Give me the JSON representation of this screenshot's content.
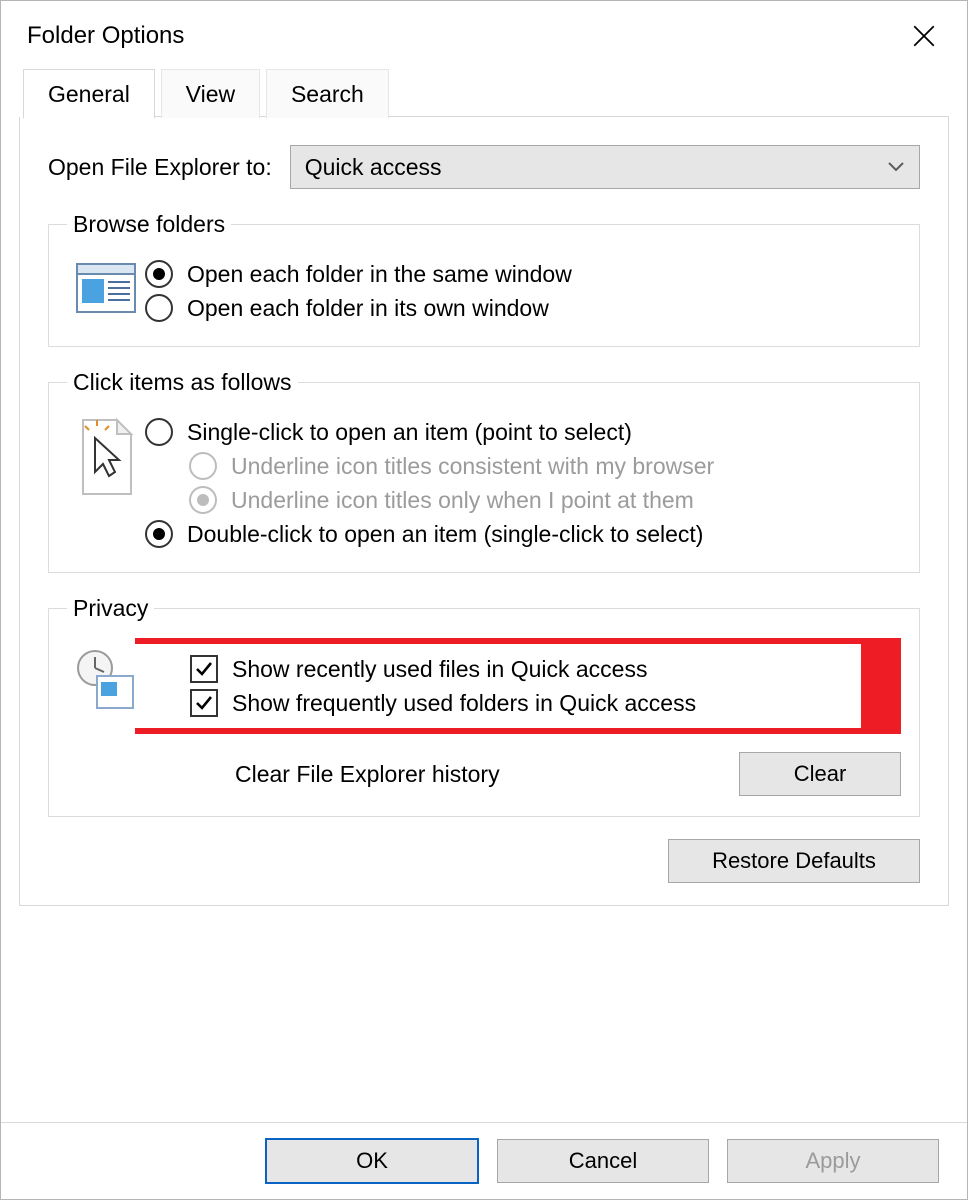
{
  "title": "Folder Options",
  "tabs": {
    "general": "General",
    "view": "View",
    "search": "Search"
  },
  "open_to": {
    "label": "Open File Explorer to:",
    "value": "Quick access"
  },
  "browse": {
    "legend": "Browse folders",
    "same": "Open each folder in the same window",
    "own": "Open each folder in its own window"
  },
  "click": {
    "legend": "Click items as follows",
    "single": "Single-click to open an item (point to select)",
    "ul_browser": "Underline icon titles consistent with my browser",
    "ul_point": "Underline icon titles only when I point at them",
    "double": "Double-click to open an item (single-click to select)"
  },
  "privacy": {
    "legend": "Privacy",
    "recent_files": "Show recently used files in Quick access",
    "freq_folders": "Show frequently used folders in Quick access",
    "clear_label": "Clear File Explorer history",
    "clear_btn": "Clear"
  },
  "restore": "Restore Defaults",
  "footer": {
    "ok": "OK",
    "cancel": "Cancel",
    "apply": "Apply"
  }
}
